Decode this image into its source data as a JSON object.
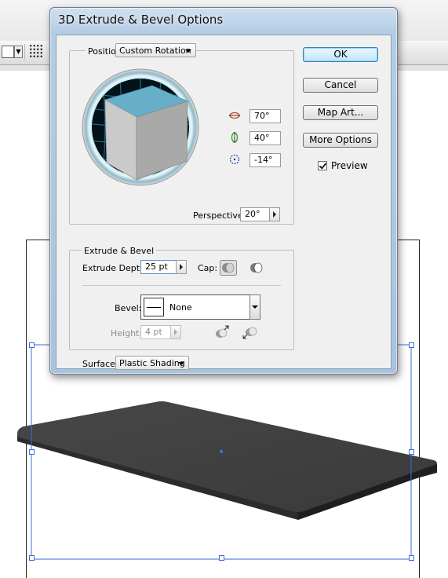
{
  "dialog": {
    "title": "3D Extrude & Bevel Options",
    "position": {
      "label": "Position:",
      "value": "Custom Rotation"
    },
    "rotation": {
      "x": {
        "icon": "rotate-x-axis-icon",
        "value": "70°"
      },
      "y": {
        "icon": "rotate-y-axis-icon",
        "value": "40°"
      },
      "z": {
        "icon": "rotate-z-axis-icon",
        "value": "-14°"
      }
    },
    "perspective": {
      "label": "Perspective:",
      "value": "20°"
    },
    "extrude": {
      "legend": "Extrude & Bevel",
      "depth_label": "Extrude Depth:",
      "depth_value": "25 pt",
      "cap_label": "Cap:",
      "bevel_label": "Bevel:",
      "bevel_value": "None",
      "height_label": "Height:",
      "height_value": "4 pt"
    },
    "surface": {
      "label": "Surface:",
      "value": "Plastic Shading"
    },
    "buttons": {
      "ok": "OK",
      "cancel": "Cancel",
      "map_art": "Map Art...",
      "more_options": "More Options"
    },
    "preview": {
      "label": "Preview",
      "checked": true
    }
  },
  "colors": {
    "cube_top": "#6aaec6",
    "cube_face": "#c8c8c8",
    "slab": "#3d3d3d",
    "selection": "#3a6cdb"
  }
}
